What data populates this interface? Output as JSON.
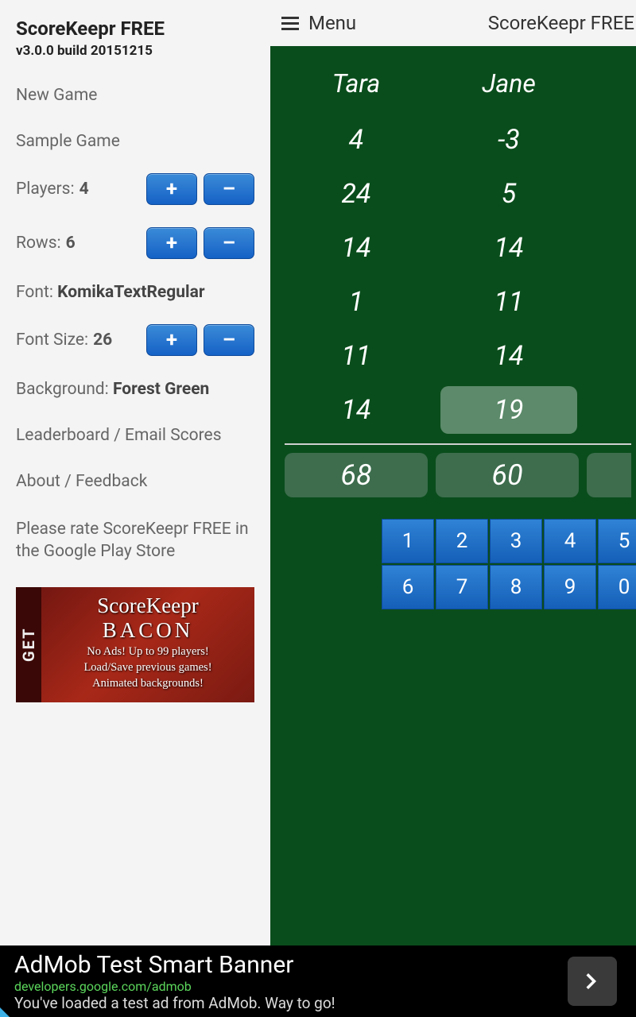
{
  "app": {
    "title": "ScoreKeepr FREE",
    "version": "v3.0.0 build 20151215",
    "header_title": "ScoreKeepr FREE",
    "menu_label": "Menu"
  },
  "sidebar": {
    "new_game": "New Game",
    "sample_game": "Sample Game",
    "players_label": "Players:",
    "players_value": "4",
    "rows_label": "Rows:",
    "rows_value": "6",
    "font_label": "Font:",
    "font_value": "KomikaTextRegular",
    "font_size_label": "Font Size:",
    "font_size_value": "26",
    "bg_label": "Background:",
    "bg_value": "Forest Green",
    "leaderboard": "Leaderboard / Email Scores",
    "about": "About / Feedback",
    "rate": "Please rate ScoreKeepr FREE in the Google Play Store",
    "plus": "+",
    "minus": "–"
  },
  "promo": {
    "get": "GET",
    "title1": "ScoreKeepr",
    "title2": "BACON",
    "line1": "No Ads! Up to 99 players!",
    "line2": "Load/Save previous games!",
    "line3": "Animated backgrounds!"
  },
  "players": [
    {
      "name": "Tara",
      "scores": [
        "4",
        "24",
        "14",
        "1",
        "11",
        "14"
      ],
      "total": "68"
    },
    {
      "name": "Jane",
      "scores": [
        "-3",
        "5",
        "14",
        "11",
        "14",
        "19"
      ],
      "total": "60",
      "selected_row": 5
    }
  ],
  "keypad": [
    "1",
    "2",
    "3",
    "4",
    "5",
    "6",
    "7",
    "8",
    "9",
    "0"
  ],
  "ad": {
    "title": "AdMob Test Smart Banner",
    "url": "developers.google.com/admob",
    "desc": "You've loaded a test ad from AdMob. Way to go!"
  }
}
